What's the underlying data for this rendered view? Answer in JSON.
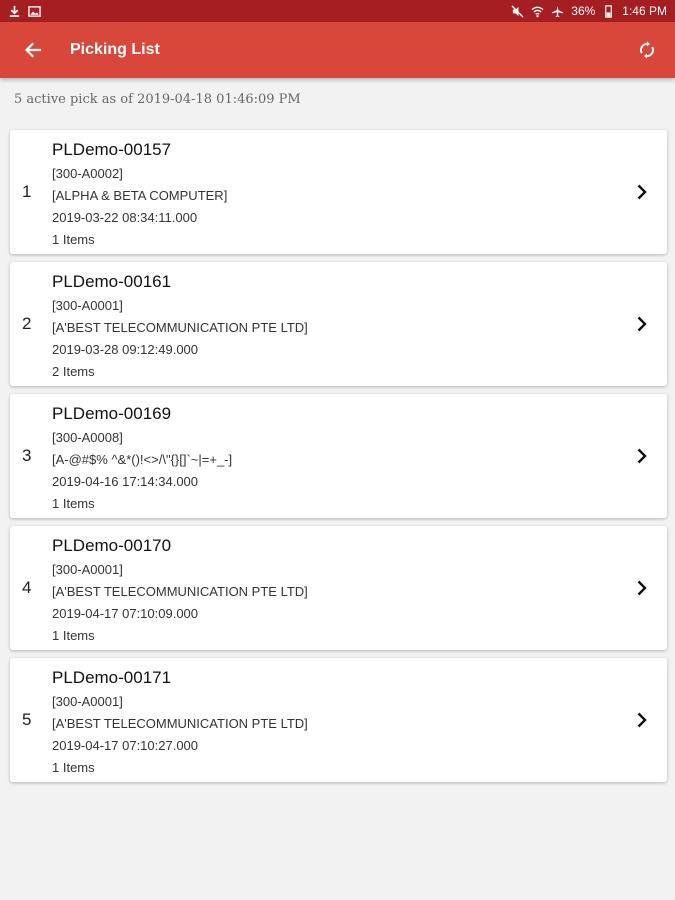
{
  "status_bar": {
    "battery": "36%",
    "time": "1:46 PM"
  },
  "app_bar": {
    "title": "Picking List"
  },
  "summary": "5 active pick as of 2019-04-18 01:46:09 PM",
  "picks": [
    {
      "index": "1",
      "number": "PLDemo-00157",
      "code": "[300-A0002]",
      "customer": "[ALPHA & BETA COMPUTER]",
      "datetime": "2019-03-22 08:34:11.000",
      "items": "1 Items"
    },
    {
      "index": "2",
      "number": "PLDemo-00161",
      "code": "[300-A0001]",
      "customer": "[A'BEST TELECOMMUNICATION PTE LTD]",
      "datetime": "2019-03-28 09:12:49.000",
      "items": "2 Items"
    },
    {
      "index": "3",
      "number": "PLDemo-00169",
      "code": "[300-A0008]",
      "customer": "[A-@#$% ^&*()!<>/\\\"{}[]`~|=+_-]",
      "datetime": "2019-04-16 17:14:34.000",
      "items": "1 Items"
    },
    {
      "index": "4",
      "number": "PLDemo-00170",
      "code": "[300-A0001]",
      "customer": "[A'BEST TELECOMMUNICATION PTE LTD]",
      "datetime": "2019-04-17 07:10:09.000",
      "items": "1 Items"
    },
    {
      "index": "5",
      "number": "PLDemo-00171",
      "code": "[300-A0001]",
      "customer": "[A'BEST TELECOMMUNICATION PTE LTD]",
      "datetime": "2019-04-17 07:10:27.000",
      "items": "1 Items"
    }
  ],
  "colors": {
    "status_bar": "#a51f22",
    "app_bar": "#d8473a",
    "background": "#f2f2f2"
  },
  "icons": {
    "back": "arrow-left-icon",
    "refresh": "refresh-icon",
    "row_action": "chevron-right-icon"
  }
}
